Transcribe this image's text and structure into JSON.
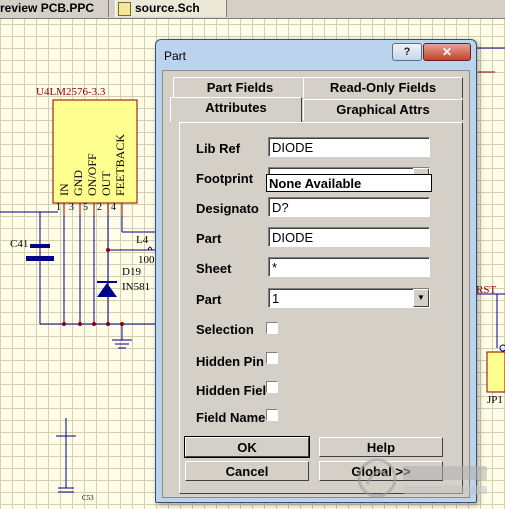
{
  "doc_tabs": {
    "pcb_tab": "review PCB.PPC",
    "sch_tab": "source.Sch"
  },
  "schematic": {
    "component_name": "U4LM2576-3.3",
    "pins": [
      "IN",
      "GND",
      "ON/OFF",
      "OUT",
      "FEETBACK"
    ],
    "pin_numbers": [
      "1",
      "3",
      "5",
      "2",
      "4"
    ],
    "capacitor": "C41",
    "inductor": "L4",
    "inductor_value": "100",
    "diode": "D19",
    "diode_part": "IN581",
    "net_label": "RST",
    "connector": "JP1",
    "capacitor2": "C53"
  },
  "dialog": {
    "title": "Part",
    "help_glyph": "?",
    "close_glyph": "✕",
    "tabs": {
      "part_fields": "Part Fields",
      "read_only_fields": "Read-Only Fields",
      "attributes": "Attributes",
      "graphical_attrs": "Graphical Attrs"
    },
    "fields": {
      "lib_ref_label": "Lib Ref",
      "lib_ref_value": "DIODE",
      "footprint_label": "Footprint",
      "footprint_value": "",
      "footprint_option": "None Available",
      "designator_label": "Designato",
      "designator_value": "D?",
      "part_label": "Part",
      "part_value": "DIODE",
      "sheet_label": "Sheet",
      "sheet_value": "*",
      "part_num_label": "Part",
      "part_num_value": "1",
      "selection_label": "Selection",
      "hidden_pins_label": "Hidden Pin",
      "hidden_fields_label": "Hidden Fiel",
      "field_names_label": "Field Name"
    },
    "buttons": {
      "ok": "OK",
      "help": "Help",
      "cancel": "Cancel",
      "global": "Global >>"
    }
  },
  "colors": {
    "schematic_bg": "#fffde8",
    "component_fill": "#ffff90",
    "wire": "#00008b",
    "pin_red": "#8b0000",
    "dialog_frame": "#bcd3ee",
    "dialog_face": "#d4d0c8"
  }
}
